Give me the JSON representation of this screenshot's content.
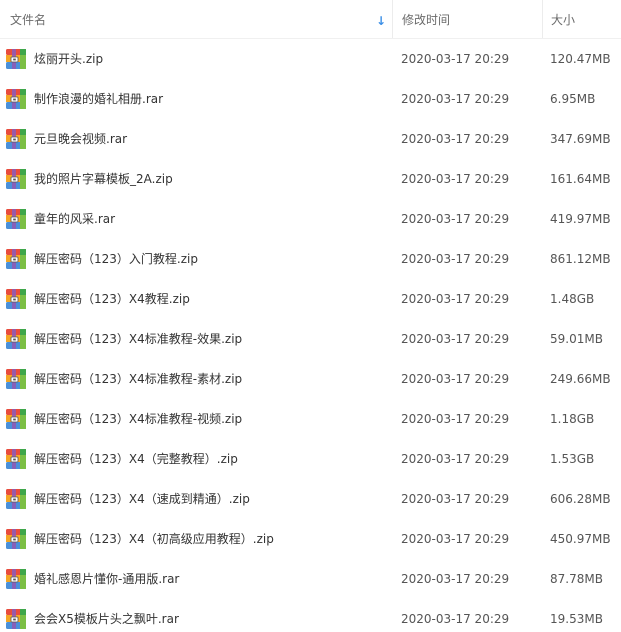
{
  "header": {
    "name_label": "文件名",
    "date_label": "修改时间",
    "size_label": "大小",
    "sort_indicator": "↓"
  },
  "colors": {
    "sort_arrow": "#3b8fe6",
    "header_text": "#6b6b6b",
    "row_text": "#333333"
  },
  "icon_type": "archive-icon",
  "files": [
    {
      "name": "炫丽开头.zip",
      "date": "2020-03-17 20:29",
      "size": "120.47MB"
    },
    {
      "name": "制作浪漫的婚礼相册.rar",
      "date": "2020-03-17 20:29",
      "size": "6.95MB"
    },
    {
      "name": "元旦晚会视频.rar",
      "date": "2020-03-17 20:29",
      "size": "347.69MB"
    },
    {
      "name": "我的照片字幕模板_2A.zip",
      "date": "2020-03-17 20:29",
      "size": "161.64MB"
    },
    {
      "name": "童年的风采.rar",
      "date": "2020-03-17 20:29",
      "size": "419.97MB"
    },
    {
      "name": "解压密码（123）入门教程.zip",
      "date": "2020-03-17 20:29",
      "size": "861.12MB"
    },
    {
      "name": "解压密码（123）X4教程.zip",
      "date": "2020-03-17 20:29",
      "size": "1.48GB"
    },
    {
      "name": "解压密码（123）X4标准教程-效果.zip",
      "date": "2020-03-17 20:29",
      "size": "59.01MB"
    },
    {
      "name": "解压密码（123）X4标准教程-素材.zip",
      "date": "2020-03-17 20:29",
      "size": "249.66MB"
    },
    {
      "name": "解压密码（123）X4标准教程-视频.zip",
      "date": "2020-03-17 20:29",
      "size": "1.18GB"
    },
    {
      "name": "解压密码（123）X4（完整教程）.zip",
      "date": "2020-03-17 20:29",
      "size": "1.53GB"
    },
    {
      "name": "解压密码（123）X4（速成到精通）.zip",
      "date": "2020-03-17 20:29",
      "size": "606.28MB"
    },
    {
      "name": "解压密码（123）X4（初高级应用教程）.zip",
      "date": "2020-03-17 20:29",
      "size": "450.97MB"
    },
    {
      "name": "婚礼感恩片懂你-通用版.rar",
      "date": "2020-03-17 20:29",
      "size": "87.78MB"
    },
    {
      "name": "会会X5模板片头之飘叶.rar",
      "date": "2020-03-17 20:29",
      "size": "19.53MB"
    }
  ]
}
